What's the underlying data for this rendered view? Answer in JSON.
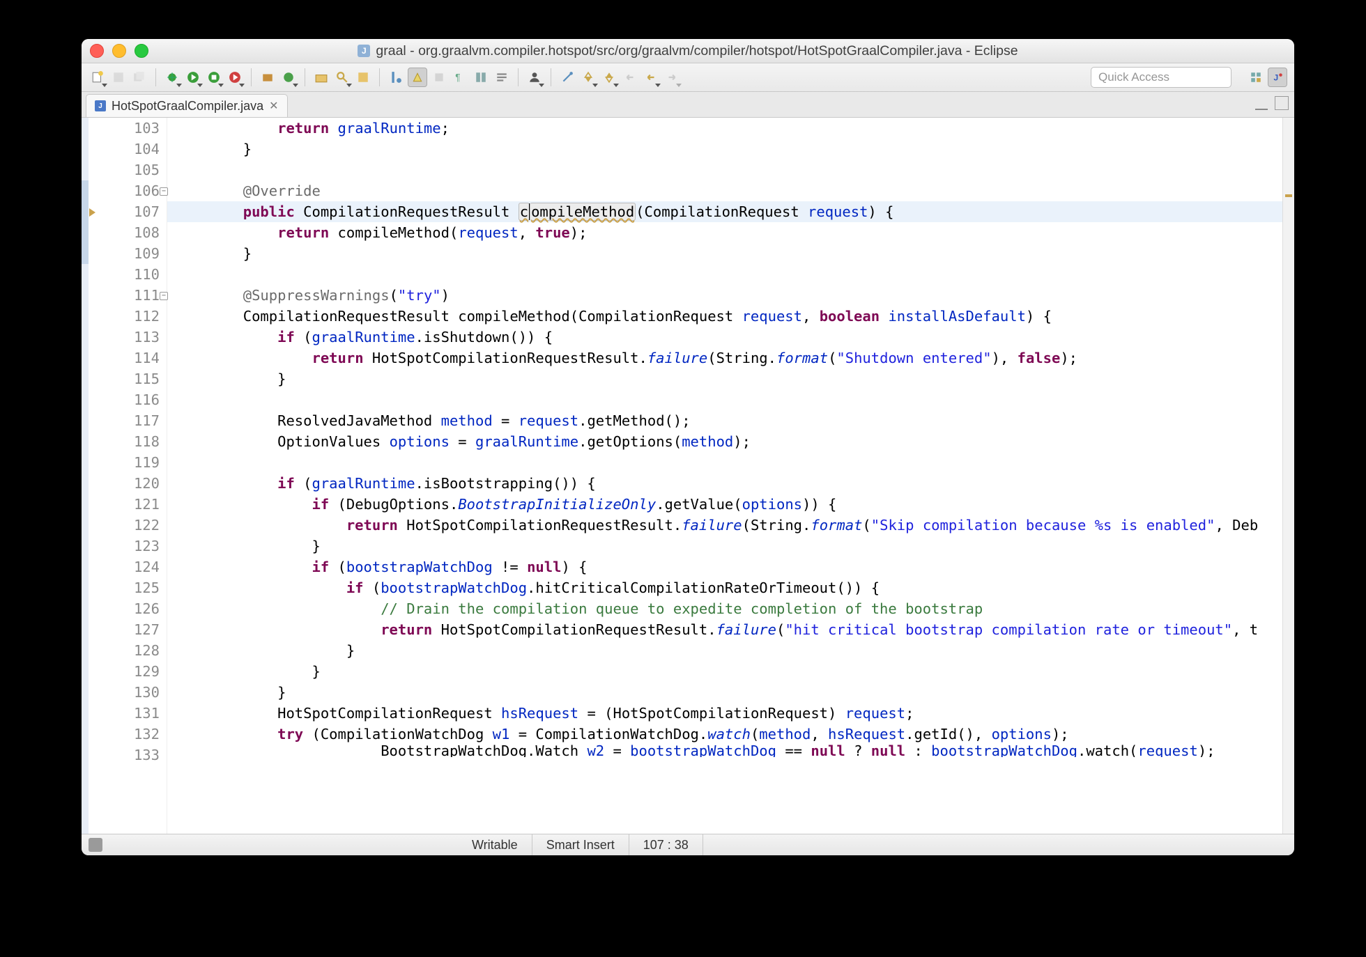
{
  "window": {
    "title": "graal - org.graalvm.compiler.hotspot/src/org/graalvm/compiler/hotspot/HotSpotGraalCompiler.java - Eclipse"
  },
  "toolbar": {
    "quick_access_placeholder": "Quick Access"
  },
  "tab": {
    "label": "HotSpotGraalCompiler.java"
  },
  "editor": {
    "current_line_hl": 107,
    "cursor_token_box": "compileMethod",
    "lines": [
      {
        "n": 103,
        "ov": false,
        "indent": 3,
        "tokens": [
          {
            "t": "return ",
            "c": "kw"
          },
          {
            "t": "graalRuntime",
            "c": "fld"
          },
          {
            "t": ";",
            "c": ""
          }
        ]
      },
      {
        "n": 104,
        "ov": false,
        "indent": 2,
        "tokens": [
          {
            "t": "}",
            "c": ""
          }
        ]
      },
      {
        "n": 105,
        "ov": false,
        "indent": 0,
        "tokens": []
      },
      {
        "n": 106,
        "ov": true,
        "fold": true,
        "indent": 2,
        "tokens": [
          {
            "t": "@Override",
            "c": "ann"
          }
        ]
      },
      {
        "n": 107,
        "ov": true,
        "hl": true,
        "warn": true,
        "indent": 2,
        "tokens": [
          {
            "t": "public",
            "c": "kw"
          },
          {
            "t": " CompilationRequestResult ",
            "c": ""
          },
          {
            "t": "c",
            "c": "boxed err"
          },
          {
            "t": "|",
            "c": "caret"
          },
          {
            "t": "ompileMethod",
            "c": "boxed err"
          },
          {
            "t": "(CompilationRequest ",
            "c": ""
          },
          {
            "t": "request",
            "c": "fld"
          },
          {
            "t": ") {",
            "c": ""
          }
        ]
      },
      {
        "n": 108,
        "ov": true,
        "indent": 3,
        "tokens": [
          {
            "t": "return",
            "c": "kw"
          },
          {
            "t": " compileMethod(",
            "c": ""
          },
          {
            "t": "request",
            "c": "fld"
          },
          {
            "t": ", ",
            "c": ""
          },
          {
            "t": "true",
            "c": "kw"
          },
          {
            "t": ");",
            "c": ""
          }
        ]
      },
      {
        "n": 109,
        "ov": true,
        "indent": 2,
        "tokens": [
          {
            "t": "}",
            "c": ""
          }
        ]
      },
      {
        "n": 110,
        "ov": false,
        "indent": 0,
        "tokens": []
      },
      {
        "n": 111,
        "ov": false,
        "fold": true,
        "indent": 2,
        "tokens": [
          {
            "t": "@SuppressWarnings",
            "c": "ann"
          },
          {
            "t": "(",
            "c": ""
          },
          {
            "t": "\"try\"",
            "c": "str"
          },
          {
            "t": ")",
            "c": ""
          }
        ]
      },
      {
        "n": 112,
        "ov": false,
        "indent": 2,
        "tokens": [
          {
            "t": "CompilationRequestResult compileMethod(CompilationRequest ",
            "c": ""
          },
          {
            "t": "request",
            "c": "fld"
          },
          {
            "t": ", ",
            "c": ""
          },
          {
            "t": "boolean",
            "c": "kw"
          },
          {
            "t": " ",
            "c": ""
          },
          {
            "t": "installAsDefault",
            "c": "fld"
          },
          {
            "t": ") {",
            "c": ""
          }
        ]
      },
      {
        "n": 113,
        "ov": false,
        "indent": 3,
        "tokens": [
          {
            "t": "if",
            "c": "kw"
          },
          {
            "t": " (",
            "c": ""
          },
          {
            "t": "graalRuntime",
            "c": "fld"
          },
          {
            "t": ".isShutdown()) {",
            "c": ""
          }
        ]
      },
      {
        "n": 114,
        "ov": false,
        "indent": 4,
        "tokens": [
          {
            "t": "return",
            "c": "kw"
          },
          {
            "t": " HotSpotCompilationRequestResult.",
            "c": ""
          },
          {
            "t": "failure",
            "c": "fldI"
          },
          {
            "t": "(String.",
            "c": ""
          },
          {
            "t": "format",
            "c": "fldI"
          },
          {
            "t": "(",
            "c": ""
          },
          {
            "t": "\"Shutdown entered\"",
            "c": "str"
          },
          {
            "t": "), ",
            "c": ""
          },
          {
            "t": "false",
            "c": "kw"
          },
          {
            "t": ");",
            "c": ""
          }
        ]
      },
      {
        "n": 115,
        "ov": false,
        "indent": 3,
        "tokens": [
          {
            "t": "}",
            "c": ""
          }
        ]
      },
      {
        "n": 116,
        "ov": false,
        "indent": 0,
        "tokens": []
      },
      {
        "n": 117,
        "ov": false,
        "indent": 3,
        "tokens": [
          {
            "t": "ResolvedJavaMethod ",
            "c": ""
          },
          {
            "t": "method",
            "c": "fld"
          },
          {
            "t": " = ",
            "c": ""
          },
          {
            "t": "request",
            "c": "fld"
          },
          {
            "t": ".getMethod();",
            "c": ""
          }
        ]
      },
      {
        "n": 118,
        "ov": false,
        "indent": 3,
        "tokens": [
          {
            "t": "OptionValues ",
            "c": ""
          },
          {
            "t": "options",
            "c": "fld"
          },
          {
            "t": " = ",
            "c": ""
          },
          {
            "t": "graalRuntime",
            "c": "fld"
          },
          {
            "t": ".getOptions(",
            "c": ""
          },
          {
            "t": "method",
            "c": "fld"
          },
          {
            "t": ");",
            "c": ""
          }
        ]
      },
      {
        "n": 119,
        "ov": false,
        "indent": 0,
        "tokens": []
      },
      {
        "n": 120,
        "ov": false,
        "indent": 3,
        "tokens": [
          {
            "t": "if",
            "c": "kw"
          },
          {
            "t": " (",
            "c": ""
          },
          {
            "t": "graalRuntime",
            "c": "fld"
          },
          {
            "t": ".isBootstrapping()) {",
            "c": ""
          }
        ]
      },
      {
        "n": 121,
        "ov": false,
        "indent": 4,
        "tokens": [
          {
            "t": "if",
            "c": "kw"
          },
          {
            "t": " (DebugOptions.",
            "c": ""
          },
          {
            "t": "BootstrapInitializeOnly",
            "c": "fldI"
          },
          {
            "t": ".getValue(",
            "c": ""
          },
          {
            "t": "options",
            "c": "fld"
          },
          {
            "t": ")) {",
            "c": ""
          }
        ]
      },
      {
        "n": 122,
        "ov": false,
        "indent": 5,
        "tokens": [
          {
            "t": "return",
            "c": "kw"
          },
          {
            "t": " HotSpotCompilationRequestResult.",
            "c": ""
          },
          {
            "t": "failure",
            "c": "fldI"
          },
          {
            "t": "(String.",
            "c": ""
          },
          {
            "t": "format",
            "c": "fldI"
          },
          {
            "t": "(",
            "c": ""
          },
          {
            "t": "\"Skip compilation because %s is enabled\"",
            "c": "str"
          },
          {
            "t": ", Deb",
            "c": ""
          }
        ]
      },
      {
        "n": 123,
        "ov": false,
        "indent": 4,
        "tokens": [
          {
            "t": "}",
            "c": ""
          }
        ]
      },
      {
        "n": 124,
        "ov": false,
        "indent": 4,
        "tokens": [
          {
            "t": "if",
            "c": "kw"
          },
          {
            "t": " (",
            "c": ""
          },
          {
            "t": "bootstrapWatchDog",
            "c": "fld"
          },
          {
            "t": " != ",
            "c": ""
          },
          {
            "t": "null",
            "c": "kw"
          },
          {
            "t": ") {",
            "c": ""
          }
        ]
      },
      {
        "n": 125,
        "ov": false,
        "indent": 5,
        "tokens": [
          {
            "t": "if",
            "c": "kw"
          },
          {
            "t": " (",
            "c": ""
          },
          {
            "t": "bootstrapWatchDog",
            "c": "fld"
          },
          {
            "t": ".hitCriticalCompilationRateOrTimeout()) {",
            "c": ""
          }
        ]
      },
      {
        "n": 126,
        "ov": false,
        "indent": 6,
        "tokens": [
          {
            "t": "// Drain the compilation queue to expedite completion of the bootstrap",
            "c": "cmt"
          }
        ]
      },
      {
        "n": 127,
        "ov": false,
        "indent": 6,
        "tokens": [
          {
            "t": "return",
            "c": "kw"
          },
          {
            "t": " HotSpotCompilationRequestResult.",
            "c": ""
          },
          {
            "t": "failure",
            "c": "fldI"
          },
          {
            "t": "(",
            "c": ""
          },
          {
            "t": "\"hit critical bootstrap compilation rate or timeout\"",
            "c": "str"
          },
          {
            "t": ", t",
            "c": ""
          }
        ]
      },
      {
        "n": 128,
        "ov": false,
        "indent": 5,
        "tokens": [
          {
            "t": "}",
            "c": ""
          }
        ]
      },
      {
        "n": 129,
        "ov": false,
        "indent": 4,
        "tokens": [
          {
            "t": "}",
            "c": ""
          }
        ]
      },
      {
        "n": 130,
        "ov": false,
        "indent": 3,
        "tokens": [
          {
            "t": "}",
            "c": ""
          }
        ]
      },
      {
        "n": 131,
        "ov": false,
        "indent": 3,
        "tokens": [
          {
            "t": "HotSpotCompilationRequest ",
            "c": ""
          },
          {
            "t": "hsRequest",
            "c": "fld"
          },
          {
            "t": " = (HotSpotCompilationRequest) ",
            "c": ""
          },
          {
            "t": "request",
            "c": "fld"
          },
          {
            "t": ";",
            "c": ""
          }
        ]
      },
      {
        "n": 132,
        "ov": false,
        "indent": 3,
        "tokens": [
          {
            "t": "try",
            "c": "kw"
          },
          {
            "t": " (CompilationWatchDog ",
            "c": ""
          },
          {
            "t": "w1",
            "c": "fld"
          },
          {
            "t": " = CompilationWatchDog.",
            "c": ""
          },
          {
            "t": "watch",
            "c": "fldI"
          },
          {
            "t": "(",
            "c": ""
          },
          {
            "t": "method",
            "c": "fld"
          },
          {
            "t": ", ",
            "c": ""
          },
          {
            "t": "hsRequest",
            "c": "fld"
          },
          {
            "t": ".getId(), ",
            "c": ""
          },
          {
            "t": "options",
            "c": "fld"
          },
          {
            "t": ");",
            "c": ""
          }
        ]
      },
      {
        "n": 133,
        "ov": false,
        "cut": true,
        "indent": 6,
        "tokens": [
          {
            "t": "BootstrapWatchDog.Watch ",
            "c": ""
          },
          {
            "t": "w2",
            "c": "fld"
          },
          {
            "t": " = ",
            "c": ""
          },
          {
            "t": "bootstrapWatchDog",
            "c": "fld"
          },
          {
            "t": " == ",
            "c": ""
          },
          {
            "t": "null",
            "c": "kw"
          },
          {
            "t": " ? ",
            "c": ""
          },
          {
            "t": "null",
            "c": "kw"
          },
          {
            "t": " : ",
            "c": ""
          },
          {
            "t": "bootstrapWatchDog",
            "c": "fld"
          },
          {
            "t": ".watch(",
            "c": ""
          },
          {
            "t": "request",
            "c": "fld"
          },
          {
            "t": ");",
            "c": ""
          }
        ]
      }
    ]
  },
  "status": {
    "writable": "Writable",
    "insert_mode": "Smart Insert",
    "cursor": "107 : 38"
  }
}
